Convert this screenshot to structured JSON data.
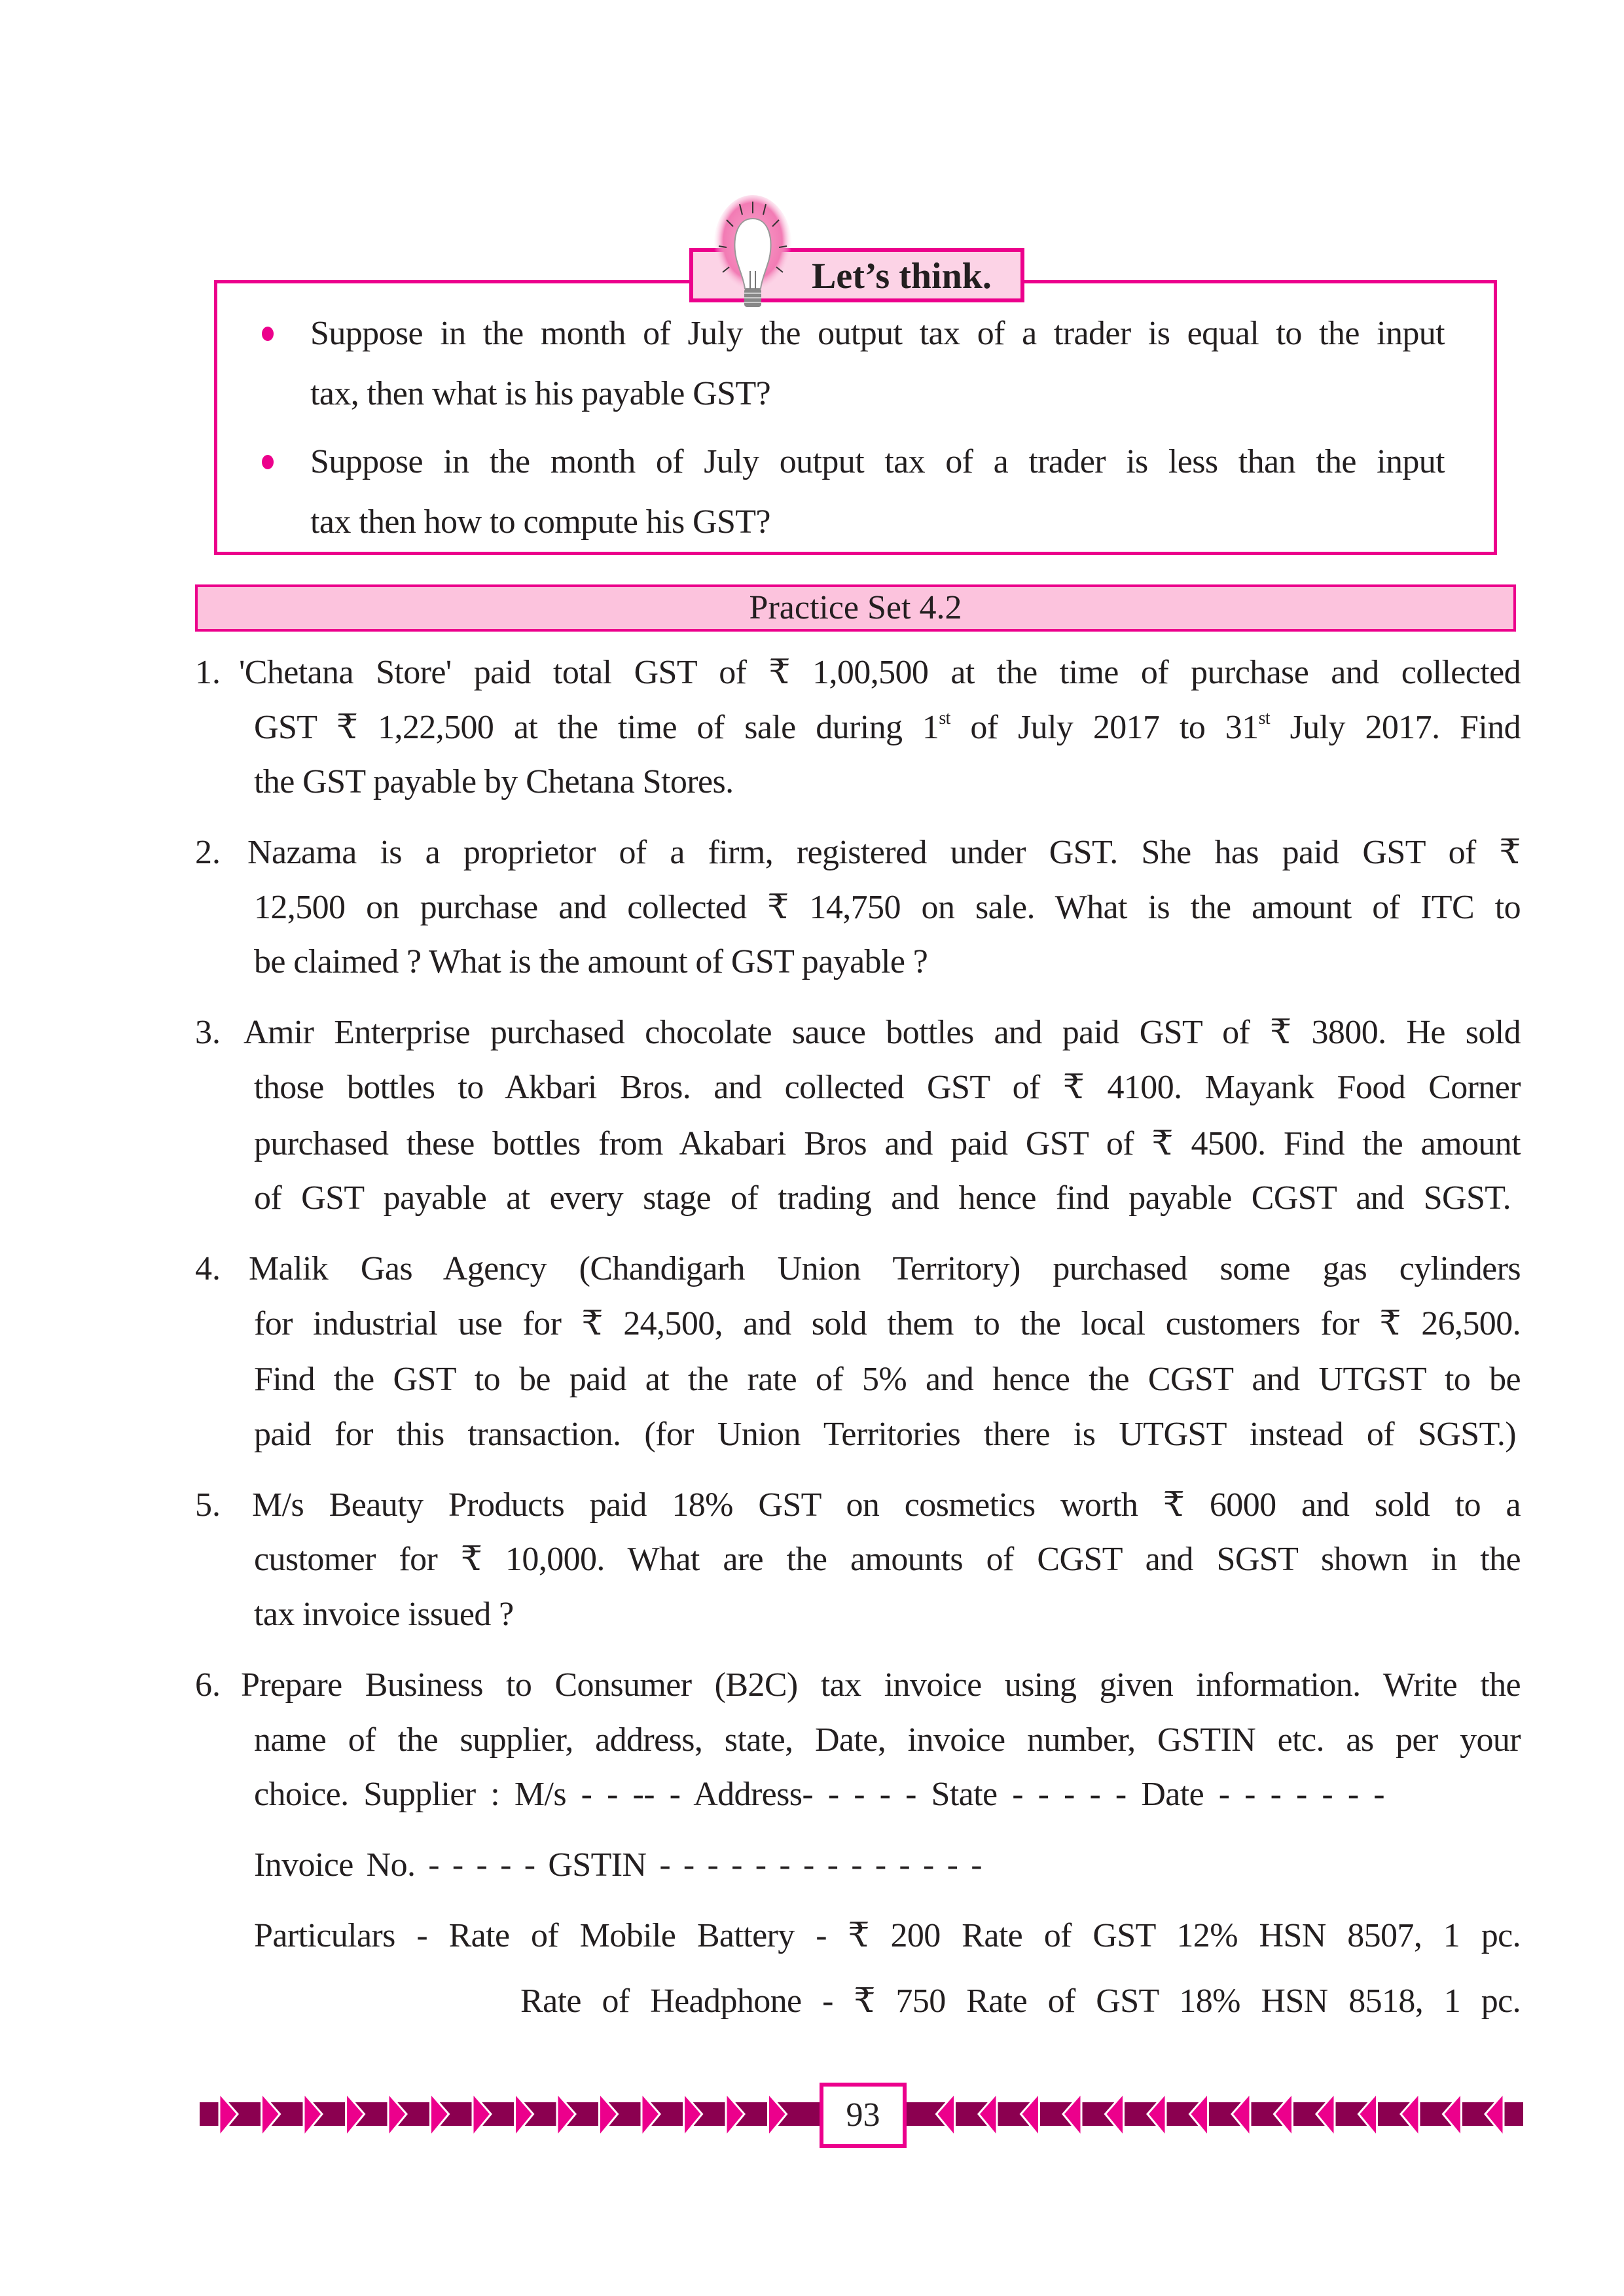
{
  "think": {
    "title": "Let’s think.",
    "bullets": [
      {
        "lines": [
          "Suppose in the month of July the output tax of a trader is equal to the input",
          "tax, then what is his payable GST?"
        ]
      },
      {
        "lines": [
          "Suppose in the month of July output tax of a trader is less than the input",
          "tax then how to compute his GST?"
        ]
      }
    ]
  },
  "practice": {
    "title": "Practice Set 4.2",
    "questions": [
      {
        "number": "1.",
        "lines": [
          "'Chetana Store' paid total GST of ₹  1,00,500 at the time of purchase and collected",
          "GST ₹  1,22,500 at the time of sale during 1",
          "the GST payable by Chetana Stores."
        ],
        "q1_line2": {
          "a": "GST ₹  1,22,500 at the time of sale during 1",
          "sup1": "st",
          "b": " of July 2017 to 31",
          "sup2": "st",
          "c": " July 2017. Find"
        }
      },
      {
        "number": "2.",
        "lines": [
          "Nazama is a proprietor of a firm, registered under GST. She has paid GST of ₹",
          "12,500 on purchase and collected ₹  14,750 on sale. What is the amount of ITC to",
          "be claimed ? What is the amount of GST payable ?"
        ]
      },
      {
        "number": "3.",
        "lines": [
          "Amir Enterprise purchased chocolate sauce bottles and paid GST of ₹  3800. He sold",
          "those bottles to Akbari Bros. and collected GST of ₹  4100. Mayank Food Corner",
          "purchased these bottles from Akabari Bros and paid GST of ₹  4500. Find the amount",
          "of GST payable at every stage of trading and hence find payable CGST and SGST."
        ]
      },
      {
        "number": "4.",
        "lines": [
          "Malik Gas Agency (Chandigarh Union Territory) purchased some gas cylinders",
          "for industrial use for ₹  24,500, and sold them to the local customers for ₹  26,500.",
          "Find the GST to be paid at the rate of 5% and hence the CGST and UTGST to be",
          "paid for this transaction. (for Union Territories there is UTGST instead of SGST.)"
        ]
      },
      {
        "number": "5.",
        "lines": [
          "M/s Beauty Products paid 18% GST on cosmetics worth ₹  6000 and sold to a",
          "customer for ₹  10,000. What are the amounts of CGST and SGST shown in the",
          "tax invoice issued ?"
        ]
      },
      {
        "number": "6.",
        "lines": [
          "Prepare Business to Consumer (B2C) tax invoice using given information. Write the",
          "name of the supplier, address, state, Date, invoice number, GSTIN etc. as per your",
          "choice. Supplier : M/s - - -- -  Address- - - - - State - - - - - Date - - - - - - -",
          "Invoice No. - - - - - GSTIN - - - - - - - - - - - - - -",
          "Particulars - Rate of Mobile Battery -  ₹ 200  Rate of GST 12%   HSN 8507, 1 pc.",
          "Rate of Headphone - ₹ 750   Rate of GST 18%  HSN 8518, 1 pc."
        ]
      }
    ]
  },
  "footer": {
    "page_number": "93"
  },
  "colors": {
    "accent": "#ec008c",
    "dark_accent": "#8b0050",
    "tab_fill": "#fcd3e6",
    "bar_fill": "#fcc3dd"
  }
}
